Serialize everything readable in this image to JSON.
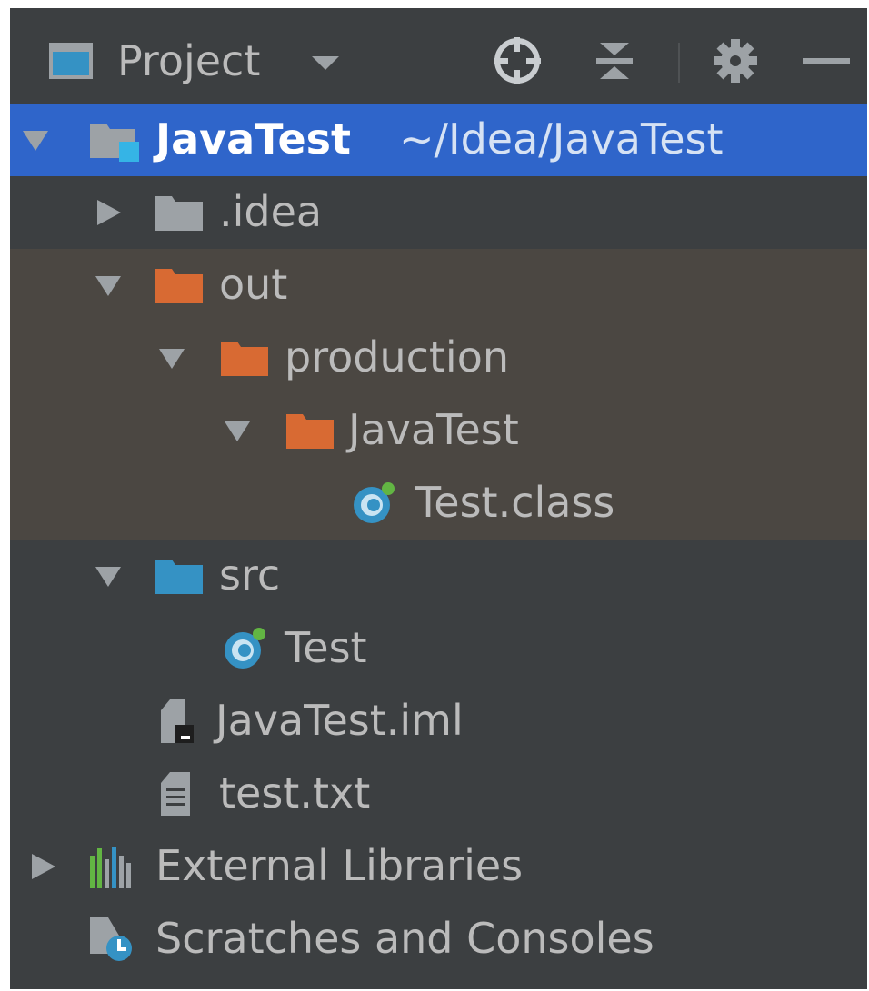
{
  "toolbar": {
    "title": "Project",
    "icons": [
      "project-view-icon",
      "dropdown-arrow-icon",
      "locate-target-icon",
      "collapse-all-icon",
      "gear-icon",
      "minimize-icon"
    ]
  },
  "tree": {
    "root": {
      "name": "JavaTest",
      "path": "~/Idea/JavaTest"
    },
    "idea": {
      "name": ".idea"
    },
    "out": {
      "name": "out"
    },
    "production": {
      "name": "production"
    },
    "javatest_folder": {
      "name": "JavaTest"
    },
    "test_class": {
      "name": "Test.class"
    },
    "src": {
      "name": "src"
    },
    "test": {
      "name": "Test"
    },
    "iml": {
      "name": "JavaTest.iml"
    },
    "txt": {
      "name": "test.txt"
    },
    "external": {
      "name": "External Libraries"
    },
    "scratches": {
      "name": "Scratches and Consoles"
    }
  },
  "colors": {
    "panel_bg": "#3c3f41",
    "selection": "#2f65ca",
    "excluded_bg": "#4b4742",
    "excluded_folder": "#d86a33",
    "source_folder": "#3592c4",
    "plain_folder": "#9da2a6",
    "text": "#bbbbbb"
  }
}
